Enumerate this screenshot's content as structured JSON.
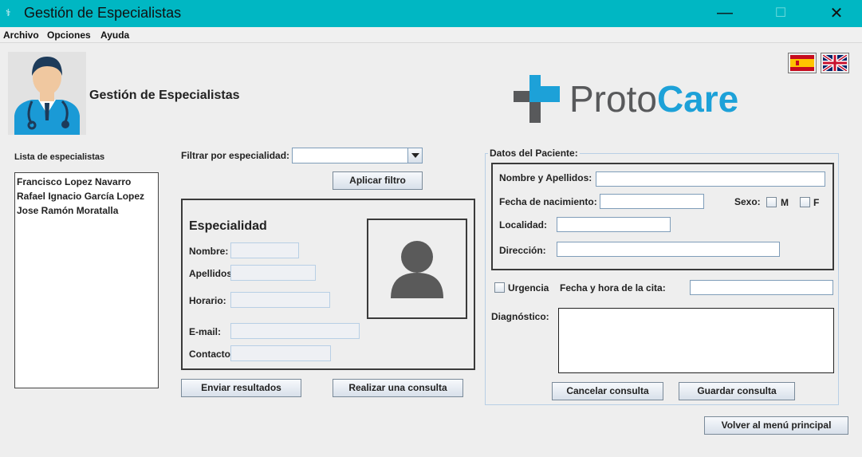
{
  "window": {
    "title": "Gestión de Especialistas",
    "minimize": "—",
    "maximize": "☐",
    "close": "✕"
  },
  "menu": [
    "Archivo",
    "Opciones",
    "Ayuda"
  ],
  "header": {
    "title": "Gestión de Especialistas",
    "logo_proto": "Proto",
    "logo_care": "Care"
  },
  "colors": {
    "titlebar": "#00b7c3",
    "logo_gray": "#58595b",
    "logo_blue": "#1da1d8"
  },
  "specialists": {
    "label": "Lista de especialistas",
    "items": [
      "Francisco Lopez Navarro",
      "Rafael Ignacio García Lopez",
      "Jose Ramón Moratalla"
    ]
  },
  "filter": {
    "label": "Filtrar por especialidad:",
    "selected": "",
    "apply_button": "Aplicar filtro"
  },
  "specialty": {
    "heading": "Especialidad",
    "nombre": "Nombre:",
    "apellidos": "Apellidos",
    "horario": "Horario:",
    "email": "E-mail:",
    "contacto": "Contacto"
  },
  "actions": {
    "send": "Enviar resultados",
    "consult": "Realizar una consulta",
    "back": "Volver al menú principal"
  },
  "patient": {
    "legend": "Datos del Paciente:",
    "nombre": "Nombre y Apellidos:",
    "fecha": "Fecha de nacimiento:",
    "sexo": "Sexo:",
    "sexo_m": "M",
    "sexo_f": "F",
    "localidad": "Localidad:",
    "direccion": "Dirección:",
    "urgencia": "Urgencia",
    "cita": "Fecha y hora de la cita:",
    "diagnostico": "Diagnóstico:",
    "cancel": "Cancelar consulta",
    "save": "Guardar consulta"
  }
}
